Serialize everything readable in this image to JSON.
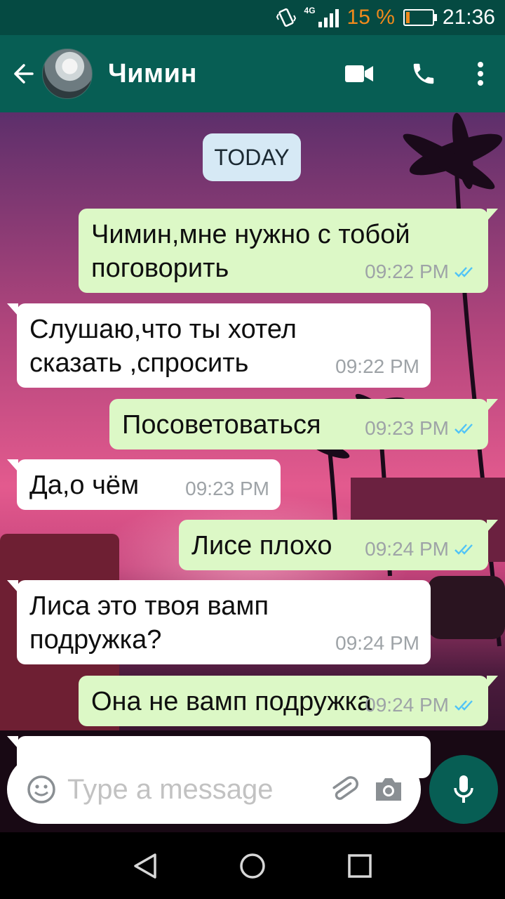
{
  "status_bar": {
    "network": "4G",
    "battery_percent": "15 %",
    "battery_level": 0.15,
    "time": "21:36"
  },
  "header": {
    "contact_name": "Чимин",
    "icons": [
      "back-arrow-icon",
      "video-call-icon",
      "phone-icon",
      "more-vertical-icon"
    ]
  },
  "chat": {
    "date_chip": "TODAY",
    "messages": [
      {
        "direction": "out",
        "text": "Чимин,мне нужно с тобой\nпоговорить",
        "time": "09:22 PM",
        "status": "read"
      },
      {
        "direction": "in",
        "text": "Слушаю,что ты хотел\nсказать ,спросить",
        "time": "09:22 PM"
      },
      {
        "direction": "out",
        "text": "Посоветоваться",
        "time": "09:23 PM",
        "status": "read"
      },
      {
        "direction": "in",
        "text": "Да,о чём",
        "time": "09:23 PM"
      },
      {
        "direction": "out",
        "text": "Лисе плохо",
        "time": "09:24 PM",
        "status": "read"
      },
      {
        "direction": "in",
        "text": "Лиса это твоя вамп\nподружка?",
        "time": "09:24 PM"
      },
      {
        "direction": "out",
        "text": "Она не вамп подружка",
        "time": "09:24 PM",
        "status": "read"
      }
    ]
  },
  "composer": {
    "placeholder": "Type a message",
    "icons": [
      "emoji-icon",
      "attachment-icon",
      "camera-icon",
      "microphone-icon"
    ]
  },
  "colors": {
    "header": "#075e54",
    "status_bar": "#054a42",
    "outgoing_bubble": "#dcf8c6",
    "incoming_bubble": "#ffffff",
    "read_ticks": "#4fc3f7",
    "battery_warning": "#f08a1c"
  },
  "navigation": {
    "icons": [
      "back-triangle-icon",
      "home-circle-icon",
      "recents-square-icon"
    ]
  }
}
